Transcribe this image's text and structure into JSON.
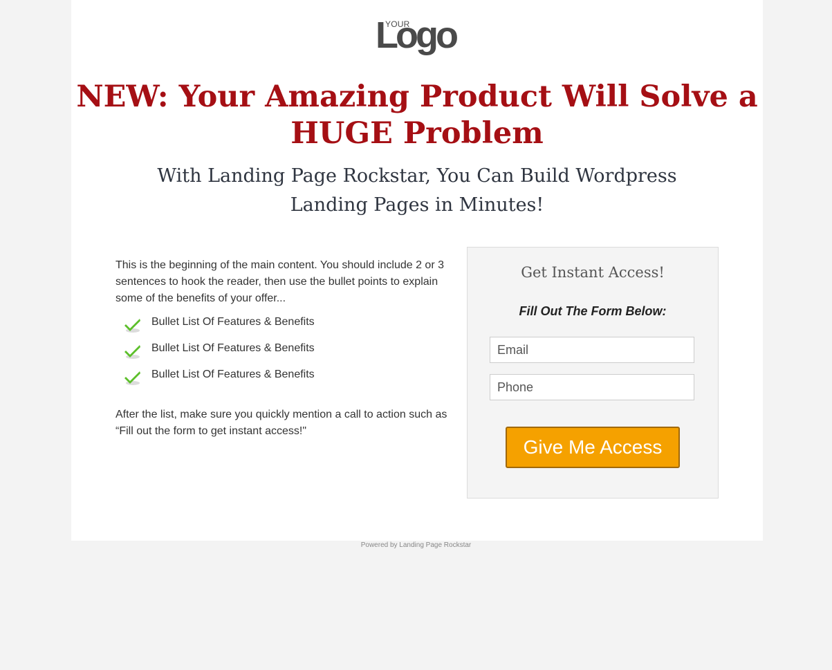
{
  "logo": {
    "small": "YOUR",
    "word": "Logo"
  },
  "headline": "NEW: Your Amazing Product Will Solve a HUGE Problem",
  "subheadline": "With Landing Page Rockstar, You Can Build Wordpress Landing Pages in Minutes!",
  "content": {
    "intro": "This is the beginning of the main content. You should include 2 or 3 sentences to hook the reader, then use the bullet points to explain some of the benefits of your offer...",
    "bullets": [
      "Bullet List Of Features & Benefits",
      "Bullet List Of Features & Benefits",
      "Bullet List Of Features & Benefits"
    ],
    "outro": "After the list, make sure you quickly mention a call to action such as “Fill out the form to get instant access!\""
  },
  "form": {
    "title": "Get Instant Access!",
    "subtitle": "Fill Out The Form Below:",
    "email_placeholder": "Email",
    "phone_placeholder": "Phone",
    "button_label": "Give Me Access"
  },
  "footer": "Powered by Landing Page Rockstar",
  "colors": {
    "headline": "#a50f14",
    "button": "#f5a100",
    "background": "#f3f3f3"
  },
  "icons": {
    "bullet": "check-icon"
  }
}
